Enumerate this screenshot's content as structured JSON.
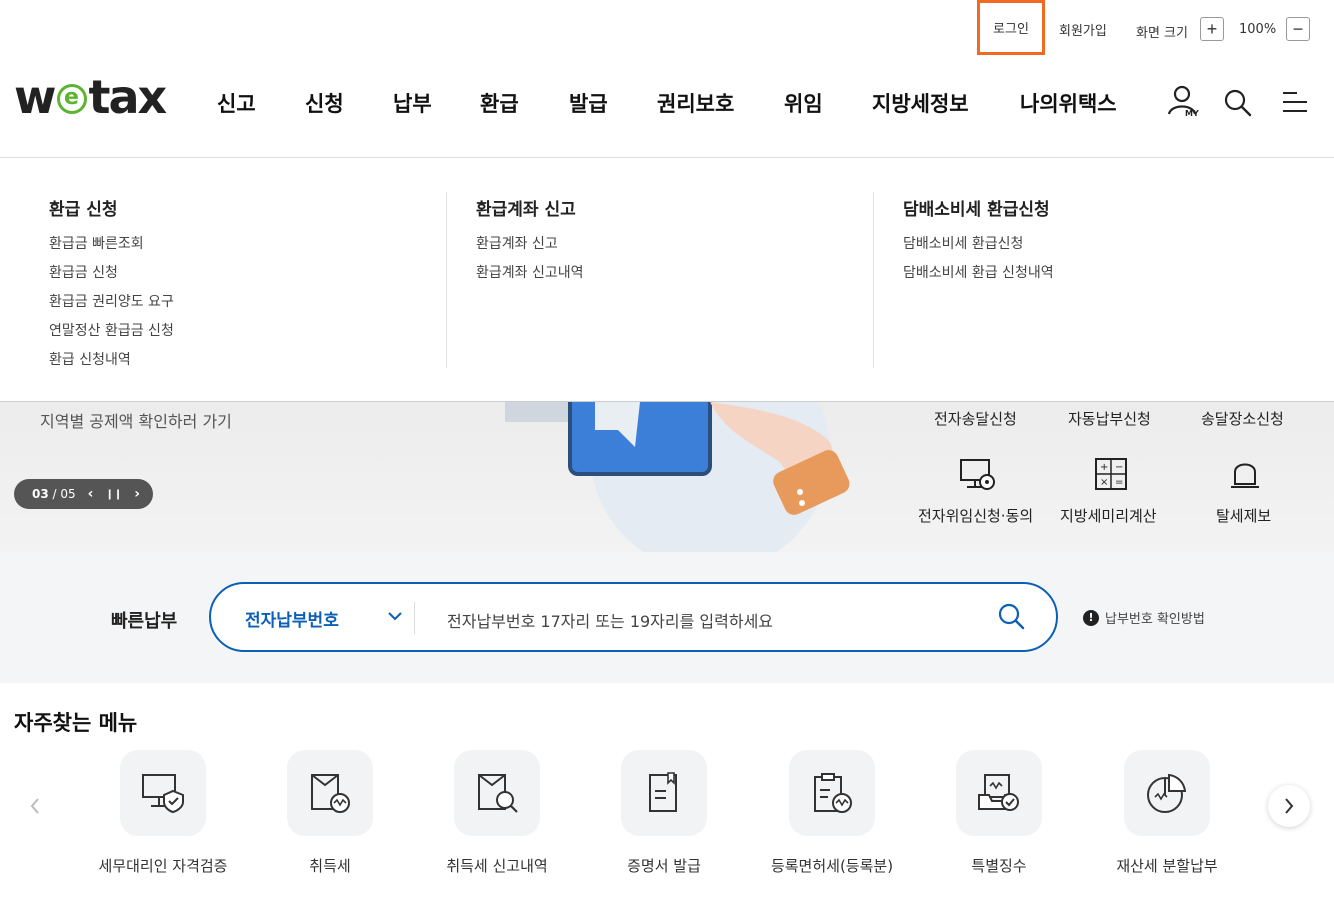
{
  "utility": {
    "login": "로그인",
    "join": "회원가입",
    "zoom_label": "화면 크기",
    "zoom_in": "+",
    "zoom_value": "100%",
    "zoom_out": "−"
  },
  "logo": {
    "w": "w",
    "e": "e",
    "tax": "tax"
  },
  "gnb": {
    "items": [
      "신고",
      "신청",
      "납부",
      "환급",
      "발급",
      "권리보호",
      "위임",
      "지방세정보",
      "나의위택스"
    ],
    "my_label": "MY"
  },
  "dropdown": {
    "columns": [
      {
        "title": "환급 신청",
        "links": [
          "환급금 빠른조회",
          "환급금 신청",
          "환급금 권리양도 요구",
          "연말정산 환급금 신청",
          "환급 신청내역"
        ]
      },
      {
        "title": "환급계좌 신고",
        "links": [
          "환급계좌 신고",
          "환급계좌 신고내역"
        ]
      },
      {
        "title": "담배소비세 환급신청",
        "links": [
          "담배소비세 환급신청",
          "담배소비세 환급 신청내역"
        ]
      }
    ]
  },
  "hero": {
    "text": "지역별 공제액 확인하러 가기",
    "pager_current": "03",
    "pager_sep": " / ",
    "pager_total": "05",
    "prev": "‹",
    "pause": "❙❙",
    "next": "›",
    "quick_links": [
      "전자송달신청",
      "자동납부신청",
      "송달장소신청"
    ],
    "quick_icons": [
      "전자위임신청·동의",
      "지방세미리계산",
      "탈세제보"
    ]
  },
  "quick_pay": {
    "title": "빠른납부",
    "selected": "전자납부번호",
    "placeholder": "전자납부번호 17자리 또는 19자리를 입력하세요",
    "help_mark": "!",
    "help": "납부번호 확인방법"
  },
  "frequent": {
    "title": "자주찾는 메뉴",
    "items": [
      "세무대리인 자격검증",
      "취득세",
      "취득세 신고내역",
      "증명서 발급",
      "등록면허세(등록분)",
      "특별징수",
      "재산세 분할납부"
    ]
  },
  "colors": {
    "accent": "#0b5fb5",
    "login_highlight": "#f26a21",
    "logo_green": "#5cb531"
  }
}
